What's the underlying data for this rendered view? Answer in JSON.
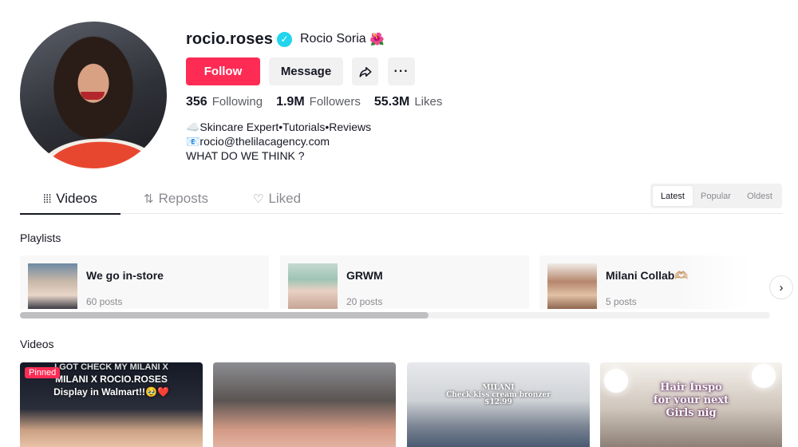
{
  "profile": {
    "username": "rocio.roses",
    "nickname": "Rocio  Soria",
    "nickname_emoji": "🌺",
    "buttons": {
      "follow": "Follow",
      "message": "Message"
    },
    "stats": [
      {
        "value": "356",
        "label": "Following"
      },
      {
        "value": "1.9M",
        "label": "Followers"
      },
      {
        "value": "55.3M",
        "label": "Likes"
      }
    ],
    "bio": [
      "☁️Skincare Expert•Tutorials•Reviews",
      "📧rocio@thelilacagency.com",
      "WHAT DO WE THINK ?"
    ]
  },
  "tabs": [
    {
      "label": "Videos",
      "icon": "grid-icon"
    },
    {
      "label": "Reposts",
      "icon": "repost-icon"
    },
    {
      "label": "Liked",
      "icon": "heart-icon"
    }
  ],
  "sort": [
    "Latest",
    "Popular",
    "Oldest"
  ],
  "playlists_title": "Playlists",
  "playlists": [
    {
      "name": "We go in-store",
      "count": "60 posts"
    },
    {
      "name": "GRWM",
      "count": "20 posts"
    },
    {
      "name": "Milani Collab🫶🏼",
      "count": "5 posts"
    }
  ],
  "videos_title": "Videos",
  "videos": [
    {
      "pinned": "Pinned",
      "caption": [
        "I GOT CHECK MY MILANI X",
        "MILANI X ROCIO.ROSES",
        "Display in Walmart!!🥹❤️"
      ]
    },
    {
      "caption": []
    },
    {
      "caption": [
        "MILANI",
        "Check kiss cream bronzer",
        "$12.99"
      ]
    },
    {
      "caption": [
        "Hair Inspo",
        "for your next",
        "Girls nig"
      ]
    }
  ],
  "colors": {
    "accent": "#fe2c55",
    "verified": "#20d5ec",
    "text": "#161823",
    "muted": "#8a8b91"
  }
}
